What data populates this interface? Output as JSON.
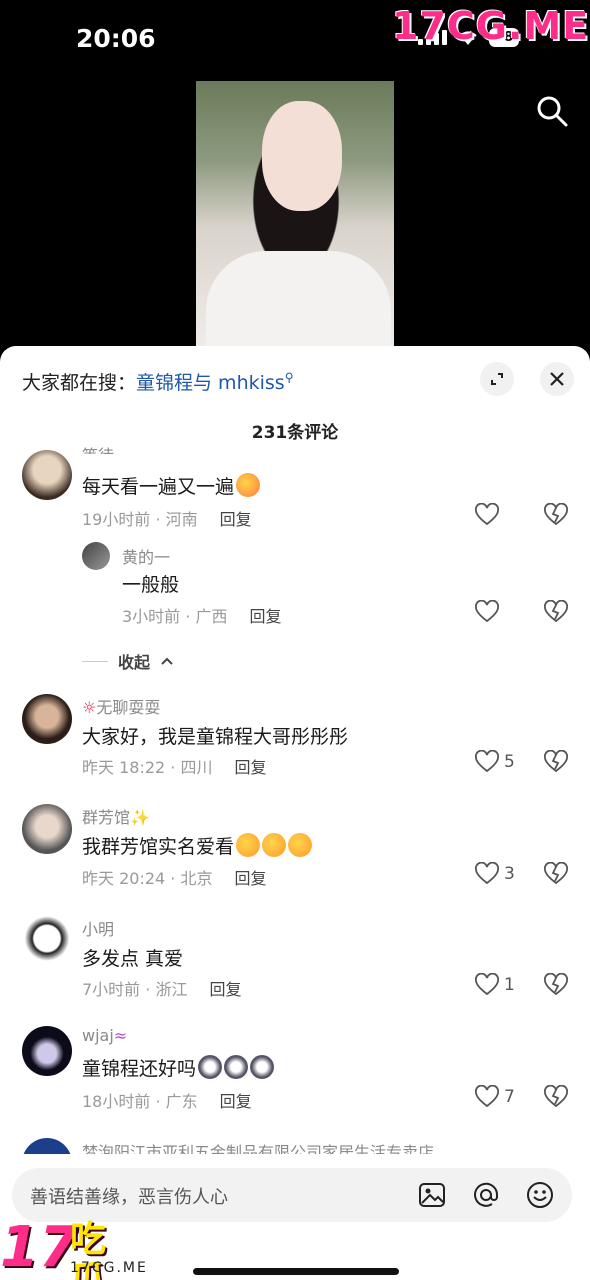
{
  "status_bar": {
    "time": "20:06",
    "battery": "58"
  },
  "watermark": {
    "top": "17CG.ME",
    "bottom_number": "17",
    "bottom_text": "吃瓜",
    "bottom_url": "17CG.ME"
  },
  "sheet": {
    "search_prefix": "大家都在搜：",
    "search_keyword": "童锦程与 mhkiss",
    "comment_count": "231条评论"
  },
  "comments": [
    {
      "name": "等待、",
      "text": "每天看一遍又一遍",
      "time": "19小时前 · 河南",
      "reply": "回复",
      "likes": ""
    },
    {
      "name": "黄的一",
      "text": "一般般",
      "time": "3小时前 · 广西",
      "reply": "回复",
      "likes": ""
    },
    {
      "name": "无聊耍耍",
      "text": "大家好，我是童锦程大哥彤彤彤",
      "time": "昨天 18:22 · 四川",
      "reply": "回复",
      "likes": "5"
    },
    {
      "name": "群芳馆",
      "text": "我群芳馆实名爱看",
      "time": "昨天 20:24 · 北京",
      "reply": "回复",
      "likes": "3"
    },
    {
      "name": "小明",
      "text": "多发点  真爱",
      "time": "7小时前 · 浙江",
      "reply": "回复",
      "likes": "1"
    },
    {
      "name": "wjaj",
      "text": "童锦程还好吗",
      "time": "18小时前 · 广东",
      "reply": "回复",
      "likes": "7"
    },
    {
      "name": "梦泡阳江市亚利五金制品有限公司家居生活专卖店"
    }
  ],
  "collapse_label": "收起",
  "composer": {
    "placeholder": "善语结善缘，恶言伤人心"
  }
}
